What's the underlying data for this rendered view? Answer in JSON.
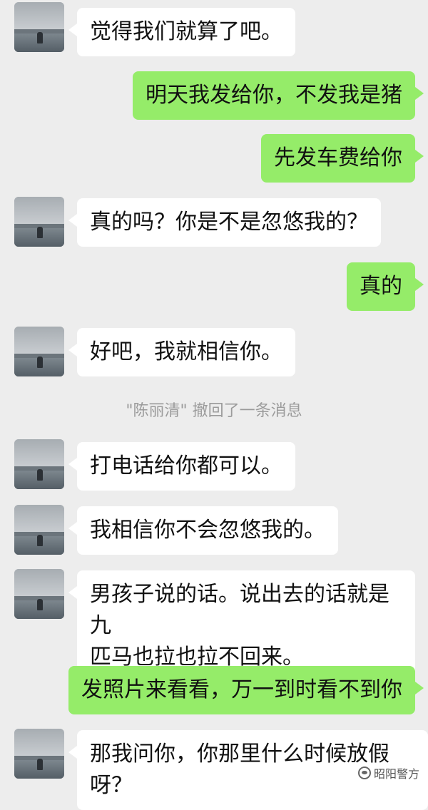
{
  "messages": [
    {
      "dir": "in",
      "text": "觉得我们就算了吧。"
    },
    {
      "dir": "out",
      "text": "明天我发给你，不发我是猪"
    },
    {
      "dir": "out",
      "text": "先发车费给你"
    },
    {
      "dir": "in",
      "text": "真的吗？你是不是忽悠我的？"
    },
    {
      "dir": "out",
      "text": "真的"
    },
    {
      "dir": "in",
      "text": "好吧，我就相信你。"
    },
    {
      "dir": "system",
      "text": "\"陈丽清\" 撤回了一条消息"
    },
    {
      "dir": "in",
      "text": "打电话给你都可以。"
    },
    {
      "dir": "in",
      "text": "我相信你不会忽悠我的。"
    },
    {
      "dir": "in",
      "text": "男孩子说的话。说出去的话就是九\n匹马也拉也拉不回来。"
    },
    {
      "dir": "out",
      "text": "发照片来看看，万一到时看不到你"
    },
    {
      "dir": "in",
      "text": "那我问你，你那里什么时候放假呀？"
    }
  ],
  "watermark": {
    "text": "昭阳警方",
    "icon": "wechat-official-account-icon"
  }
}
